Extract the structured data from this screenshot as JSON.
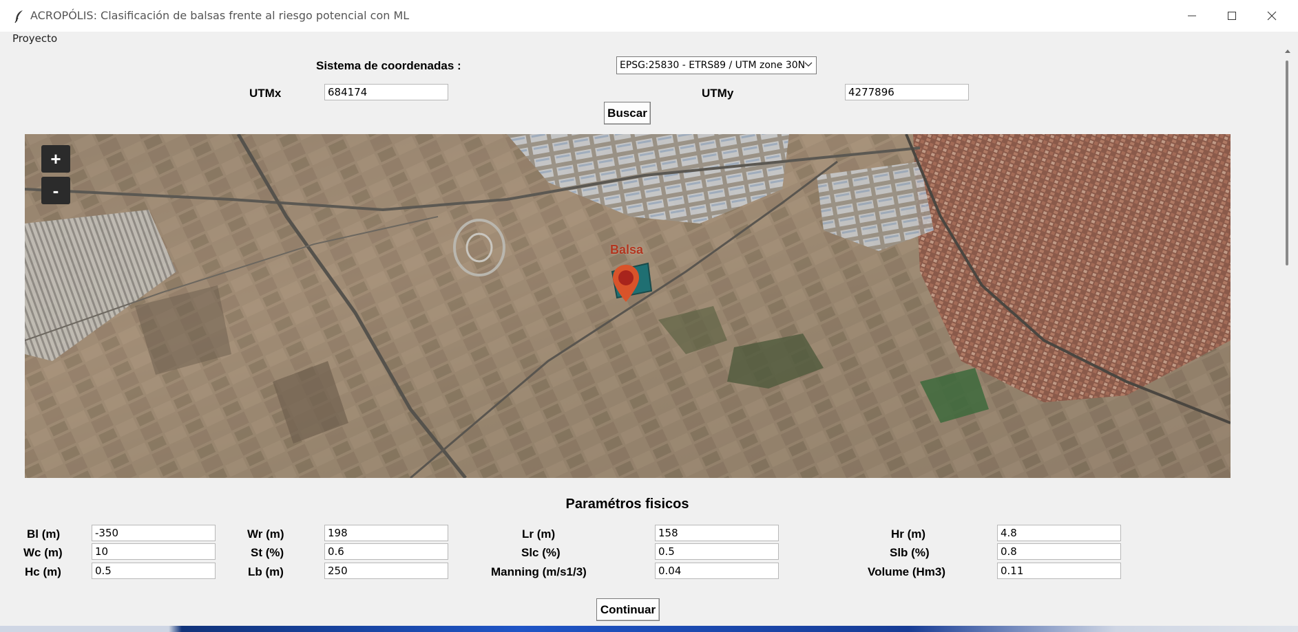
{
  "window": {
    "title": "ACROPÓLIS: Clasificación de balsas frente al riesgo potencial con ML",
    "minimize_glyph": "—",
    "maximize_glyph": "☐",
    "close_glyph": "✕"
  },
  "menu": {
    "items": [
      {
        "label": "Proyecto"
      }
    ]
  },
  "coords": {
    "system_label": "Sistema de coordenadas :",
    "system_selected": "EPSG:25830 - ETRS89 / UTM zone 30N",
    "utmx_label": "UTMx",
    "utmx_value": "684174",
    "utmy_label": "UTMy",
    "utmy_value": "4277896",
    "search_button": "Buscar"
  },
  "map": {
    "zoom_in": "+",
    "zoom_out": "-",
    "marker_label": "Balsa",
    "marker_color": "#d9532a",
    "icons": [
      "pin-icon"
    ]
  },
  "params": {
    "title": "Paramétros fisicos",
    "rows": [
      [
        {
          "label": "Bl (m)",
          "value": "-350"
        },
        {
          "label": "Wr (m)",
          "value": "198"
        },
        {
          "label": "Lr (m)",
          "value": "158"
        },
        {
          "label": "Hr (m)",
          "value": "4.8"
        }
      ],
      [
        {
          "label": "Wc (m)",
          "value": "10"
        },
        {
          "label": "St (%)",
          "value": "0.6"
        },
        {
          "label": "Slc (%)",
          "value": "0.5"
        },
        {
          "label": "Slb (%)",
          "value": "0.8"
        }
      ],
      [
        {
          "label": "Hc (m)",
          "value": "0.5"
        },
        {
          "label": "Lb (m)",
          "value": "250"
        },
        {
          "label": "Manning (m/s1/3)",
          "value": "0.04"
        },
        {
          "label": "Volume (Hm3)",
          "value": "0.11"
        }
      ]
    ],
    "continue_button": "Continuar"
  }
}
